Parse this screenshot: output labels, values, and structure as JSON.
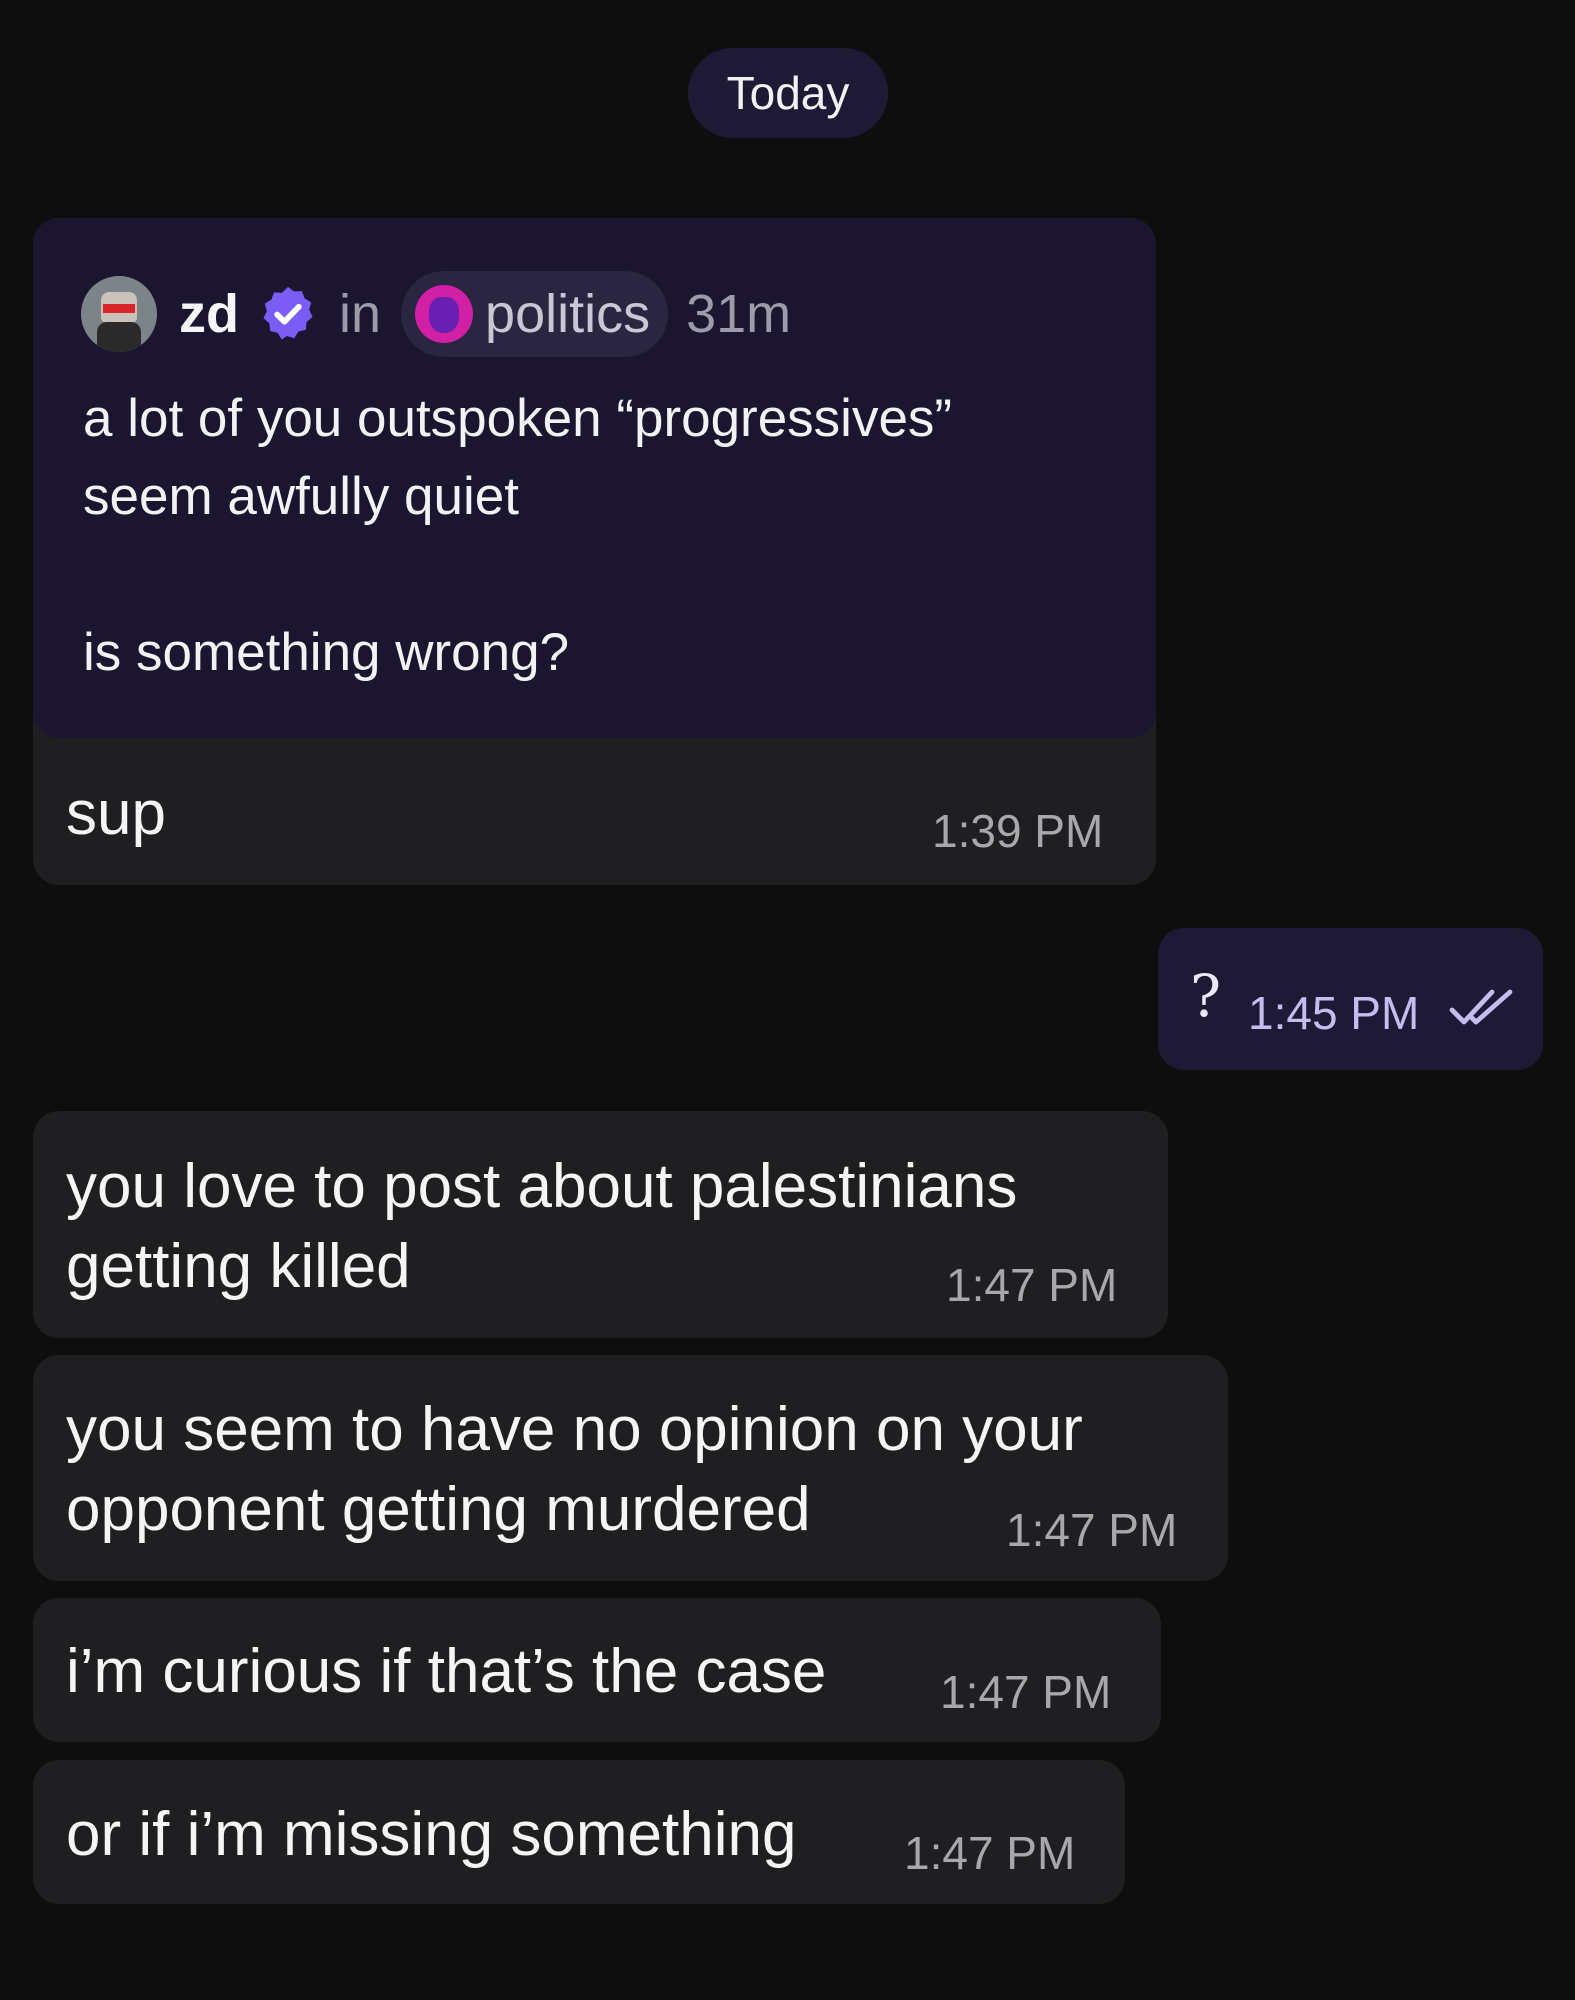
{
  "date_separator": "Today",
  "quoted_post": {
    "author": "zd",
    "in_word": "in",
    "community": "politics",
    "age": "31m",
    "body_line1": "a lot of you outspoken “progressives”",
    "body_line2": "seem awfully quiet",
    "body_line3": "is something wrong?",
    "icons": {
      "avatar": "user-avatar",
      "verified": "verified-badge-icon",
      "community": "community-icon"
    },
    "colors": {
      "verified": "#7b5cf5",
      "community_icon": "#d11fa6"
    }
  },
  "messages": [
    {
      "direction": "received",
      "lines": [
        "sup"
      ],
      "time": "1:39 PM"
    },
    {
      "direction": "sent",
      "lines": [
        "?"
      ],
      "time": "1:45 PM",
      "status": "read-double-check-icon"
    },
    {
      "direction": "received",
      "lines": [
        "you love to post about palestinians",
        "getting killed"
      ],
      "time": "1:47 PM"
    },
    {
      "direction": "received",
      "lines": [
        "you seem to have no opinion on your",
        "opponent getting murdered"
      ],
      "time": "1:47 PM"
    },
    {
      "direction": "received",
      "lines": [
        "i’m curious if that’s the case"
      ],
      "time": "1:47 PM"
    },
    {
      "direction": "received",
      "lines": [
        "or if i’m missing something"
      ],
      "time": "1:47 PM"
    }
  ],
  "theme": {
    "background": "#0e0e0f",
    "received_bubble": "#1f1f21",
    "sent_bubble": "#1e1a35",
    "post_card": "#1b1530"
  }
}
